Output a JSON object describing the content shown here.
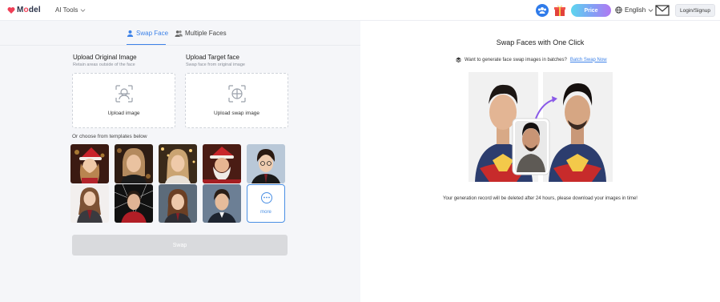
{
  "header": {
    "logo_left": "M",
    "logo_right": "del",
    "ai_tools": "AI Tools",
    "price": "Price",
    "language": "English",
    "login": "Login/Signup"
  },
  "tabs": {
    "swap_face": "Swap Face",
    "multiple_faces": "Multiple Faces"
  },
  "upload_original": {
    "title": "Upload Original Image",
    "subtitle": "Retain areas outside of the face",
    "button": "Upload image"
  },
  "upload_target": {
    "title": "Upload Target face",
    "subtitle": "Swap face from original image",
    "button": "Upload swap image"
  },
  "templates": {
    "label": "Or choose from templates below",
    "more": "more"
  },
  "swap_button": "Swap",
  "right": {
    "title": "Swap Faces with One Click",
    "batch_prompt": "Want to generate face swap images in batches?",
    "batch_link": "Batch Swap Now",
    "note": "Your generation record will be deleted after 24 hours, please download your images in time!"
  },
  "colors": {
    "accent": "#3d82e8",
    "brand_red": "#ef3f56"
  }
}
